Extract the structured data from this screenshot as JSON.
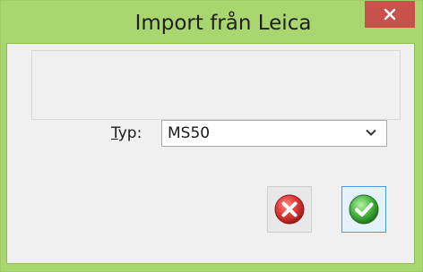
{
  "window": {
    "title": "Import från Leica",
    "close_icon": "close-x-icon"
  },
  "form": {
    "type_label_underlined": "T",
    "type_label_rest": "yp:",
    "type_value": "MS50",
    "chevron_icon": "chevron-down-icon"
  },
  "buttons": {
    "cancel_icon": "red-x-circle-icon",
    "ok_icon": "green-check-circle-icon"
  },
  "colors": {
    "frame": "#a9d66e",
    "close": "#c7514b",
    "cancel": "#d83b3b",
    "ok": "#3fae3a",
    "focus": "#4a9de0"
  }
}
